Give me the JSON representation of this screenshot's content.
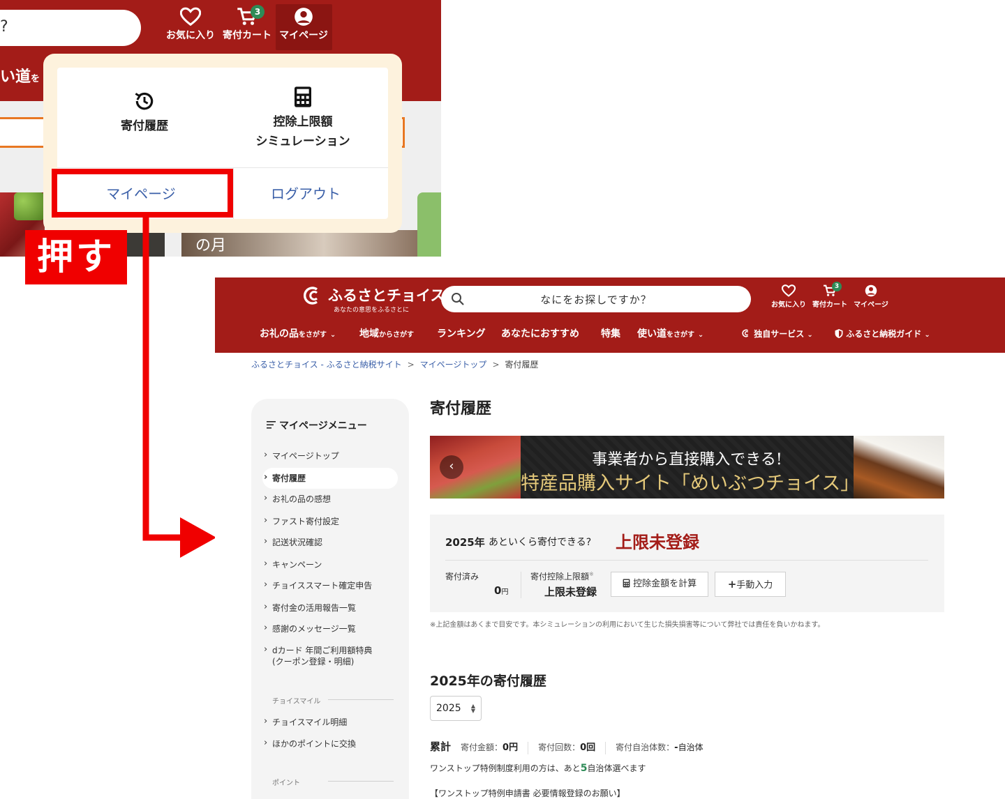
{
  "top_crop": {
    "search_fragment": "?",
    "header_icons": [
      {
        "label": "お気に入り",
        "icon": "heart-icon"
      },
      {
        "label": "寄付カート",
        "icon": "cart-icon",
        "badge": "3"
      },
      {
        "label": "マイページ",
        "icon": "user-icon"
      }
    ],
    "usage_fragment": "い道",
    "usage_fragment_small": "を",
    "food_text": "の月",
    "dropdown": {
      "history_label": "寄付履歴",
      "simulation_label_line1": "控除上限額",
      "simulation_label_line2": "シミュレーション",
      "mypage_label": "マイページ",
      "logout_label": "ログアウト"
    },
    "push_label": "押す",
    "highlight_color": "#f00000"
  },
  "page": {
    "logo": {
      "name": "ふるさとチョイス",
      "tagline": "あなたの意思をふるさとに"
    },
    "search": {
      "placeholder": "なにをお探しですか？"
    },
    "header_icons": [
      {
        "label": "お気に入り",
        "icon": "heart-icon"
      },
      {
        "label": "寄付カート",
        "icon": "cart-icon",
        "badge": "3"
      },
      {
        "label": "マイページ",
        "icon": "user-icon"
      }
    ],
    "nav": [
      {
        "main": "お礼の品",
        "sub": "をさがす",
        "caret": "⌄"
      },
      {
        "main": "地域",
        "sub": "からさがす",
        "caret": ""
      },
      {
        "main": "ランキング",
        "sub": "",
        "caret": ""
      },
      {
        "main": "あなたにおすすめ",
        "sub": "",
        "caret": ""
      },
      {
        "main": "特集",
        "sub": "",
        "caret": ""
      },
      {
        "main": "使い道",
        "sub": "をさがす",
        "caret": "⌄"
      },
      {
        "main": "独自サービス",
        "sub": "",
        "caret": "⌄"
      },
      {
        "main": "ふるさと納税ガイド",
        "sub": "",
        "caret": "⌄"
      }
    ],
    "breadcrumb": [
      "ふるさとチョイス - ふるさと納税サイト",
      "マイページトップ",
      "寄付履歴"
    ],
    "breadcrumb_sep": ">",
    "sidebar": {
      "title": "マイページメニュー",
      "items": [
        "マイページトップ",
        "寄付履歴",
        "お礼の品の感想",
        "ファスト寄付設定",
        "記送状況確認",
        "キャンペーン",
        "チョイススマート確定申告",
        "寄付金の活用報告一覧",
        "感謝のメッセージ一覧",
        "dカード 年間ご利用額特典",
        "(クーポン登録・明細)"
      ],
      "section_mile": "チョイスマイル",
      "mile_items": [
        "チョイスマイル明細",
        "ほかのポイントに交換"
      ],
      "section_point": "ポイント"
    },
    "title": "寄付履歴",
    "banner": {
      "line1": "事業者から直接購入できる!",
      "line2": "特産品購入サイト「めいぶつチョイス」",
      "prev": "‹"
    },
    "simulation": {
      "year": "2025年",
      "question": "あといくら寄付できる?",
      "status": "上限未登録",
      "donated_label": "寄付済み",
      "donated_value": "0",
      "yen": "円",
      "limit_label": "寄付控除上限額",
      "limit_mark": "※",
      "limit_value": "上限未登録",
      "calc_button": "控除金額を計算",
      "manual_button": "手動入力"
    },
    "note": "※上記金額はあくまで目安です。本シミュレーションの利用において生じた損失損害等について弊社では責任を負いかねます。",
    "history_title": "2025年の寄付履歴",
    "year_select": "2025",
    "summary": {
      "label": "累計",
      "amount_label": "寄付金額：",
      "amount_value": "0円",
      "count_label": "寄付回数：",
      "count_value": "0回",
      "muni_label": "寄付自治体数：",
      "muni_value": "-",
      "muni_unit": "自治体"
    },
    "onestop": {
      "pre": "ワンストップ特例制度利用の方は、あと",
      "num": "5",
      "post": "自治体選べます"
    },
    "request": "【ワンストップ特例申請書 必要情報登録のお願い】",
    "colors": {
      "brand_red": "#a31c18",
      "green": "#2e8b57",
      "link_blue": "#3a5fa8"
    }
  }
}
